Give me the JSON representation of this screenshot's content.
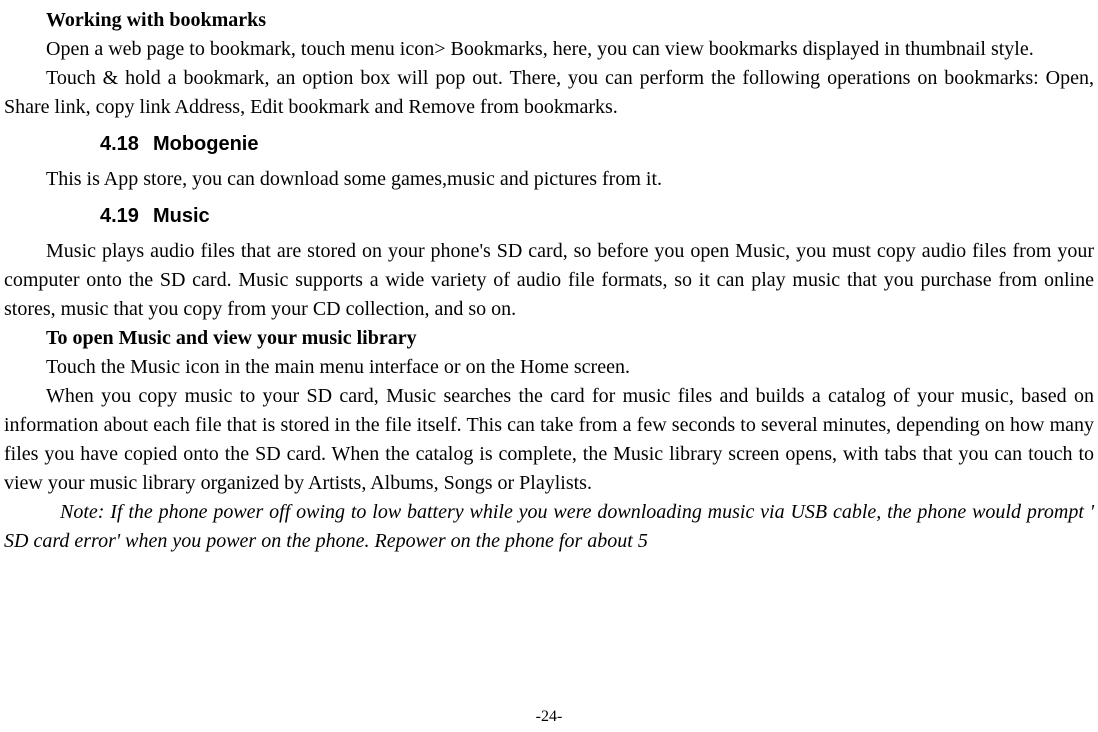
{
  "paragraphs": {
    "h1": "Working with bookmarks",
    "p1": "Open a web page to bookmark, touch menu icon> Bookmarks, here, you can view bookmarks displayed in thumbnail style.",
    "p2": "Touch & hold a bookmark, an option box will pop out. There, you can perform the following operations on bookmarks: Open, Share link, copy link Address, Edit bookmark and Remove from bookmarks.",
    "s418_num": "4.18",
    "s418_title": "Mobogenie",
    "p3": "This is App store, you can download some games,music and pictures from it.",
    "s419_num": "4.19",
    "s419_title": "Music",
    "p4": "Music plays audio files that are stored on your phone's SD card, so before you open Music, you must copy audio files from your computer onto the SD card. Music supports a wide variety of audio file formats, so it can play music that you purchase from online stores, music that you copy from your CD collection, and so on.",
    "h2": "To open Music and view your music library",
    "p5": "Touch the Music icon in the main menu interface or on the Home screen.",
    "p6": "When you copy music to your SD card, Music searches the card for music files and builds a catalog of your music, based on information about each file that is stored in the file itself. This can take from a few seconds to several minutes, depending on how many files you have copied onto the SD card. When the catalog is complete, the Music library screen opens, with tabs that you can touch to view your music library organized by Artists, Albums, Songs or Playlists.",
    "note": "Note: If the phone power off owing to low battery while you were downloading music via USB cable, the phone would prompt ' SD card error' when you power on the phone. Repower on the phone for about 5"
  },
  "page_number": "-24-"
}
